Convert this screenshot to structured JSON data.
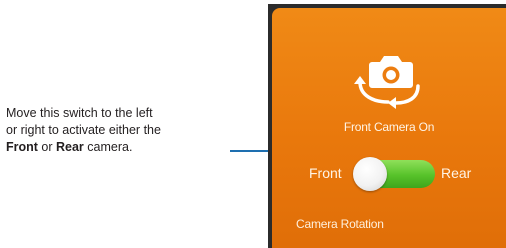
{
  "callout": {
    "line1": "Move this switch to the left",
    "line2": "or right to activate either the",
    "front_word": "Front",
    "or_word": " or ",
    "rear_word": "Rear",
    "tail": " camera."
  },
  "tile": {
    "status": "Front Camera On",
    "front_label": "Front",
    "rear_label": "Rear",
    "title": "Camera Rotation",
    "switch_state": "front",
    "icon": "camera-rotate-icon"
  },
  "colors": {
    "tile_orange": "#ec7d10",
    "switch_green": "#57c22a",
    "callout_line": "#1e6fb0"
  }
}
